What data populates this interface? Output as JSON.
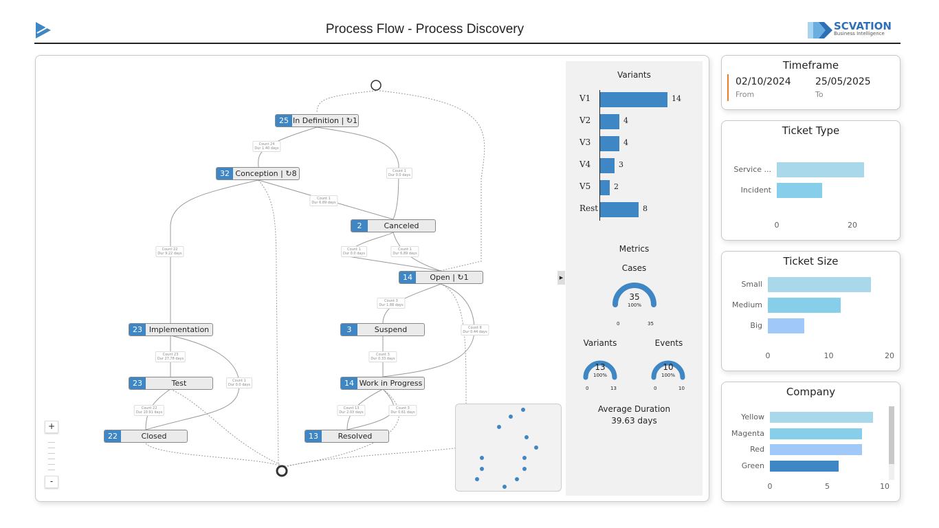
{
  "header": {
    "title": "Process Flow - Process Discovery",
    "logo_text": "SCVATION",
    "logo_sub": "Business Intelligence"
  },
  "graph": {
    "nodes": [
      {
        "count": "25",
        "label": "In Definition | ↻1"
      },
      {
        "count": "32",
        "label": "Conception | ↻8"
      },
      {
        "count": "2",
        "label": "Canceled"
      },
      {
        "count": "14",
        "label": "Open | ↻1"
      },
      {
        "count": "23",
        "label": "Implementation"
      },
      {
        "count": "3",
        "label": "Suspend"
      },
      {
        "count": "23",
        "label": "Test"
      },
      {
        "count": "14",
        "label": "Work in Progress"
      },
      {
        "count": "22",
        "label": "Closed"
      },
      {
        "count": "13",
        "label": "Resolved"
      }
    ],
    "edges": [
      {
        "count": "Count 24",
        "dur": "Dur 1.40 days"
      },
      {
        "count": "Count 1",
        "dur": "Dur 0.0 days"
      },
      {
        "count": "Count 1",
        "dur": "Dur 6.89 days"
      },
      {
        "count": "Count 22",
        "dur": "Dur 9.22 days"
      },
      {
        "count": "Count 1",
        "dur": "Dur 0.0 days"
      },
      {
        "count": "Count 1",
        "dur": "Dur 6.89 days"
      },
      {
        "count": "Count 3",
        "dur": "Dur 1.88 days"
      },
      {
        "count": "Count 8",
        "dur": "Dur 0.44 days"
      },
      {
        "count": "Count 23",
        "dur": "Dur 27.78 days"
      },
      {
        "count": "Count 3",
        "dur": "Dur 0.33 days"
      },
      {
        "count": "Count 1",
        "dur": "Dur 0.0 days"
      },
      {
        "count": "Count 22",
        "dur": "Dur 10.91 days"
      },
      {
        "count": "Count 13",
        "dur": "Dur 2.03 days"
      },
      {
        "count": "Count 3",
        "dur": "Dur 0.61 days"
      }
    ],
    "zoom_in": "+",
    "zoom_out": "-"
  },
  "variants": {
    "title": "Variants",
    "color": "#3f87c4",
    "items": [
      {
        "label": "V1",
        "value": 14
      },
      {
        "label": "V2",
        "value": 4
      },
      {
        "label": "V3",
        "value": 4
      },
      {
        "label": "V4",
        "value": 3
      },
      {
        "label": "V5",
        "value": 2
      },
      {
        "label": "Rest",
        "value": 8
      }
    ]
  },
  "metrics": {
    "title": "Metrics",
    "cases": {
      "label": "Cases",
      "value": "35",
      "pct": "100%",
      "min": "0",
      "max": "35"
    },
    "variants": {
      "label": "Variants",
      "value": "13",
      "pct": "100%",
      "min": "0",
      "max": "13"
    },
    "events": {
      "label": "Events",
      "value": "10",
      "pct": "100%",
      "min": "0",
      "max": "10"
    },
    "avg_label": "Average Duration",
    "avg_value": "39.63 days"
  },
  "timeframe": {
    "title": "Timeframe",
    "from": "02/10/2024",
    "from_label": "From",
    "to": "25/05/2025",
    "to_label": "To",
    "accent": "#e8801f"
  },
  "chart_data": [
    {
      "type": "bar",
      "title": "Variants",
      "categories": [
        "V1",
        "V2",
        "V3",
        "V4",
        "V5",
        "Rest"
      ],
      "values": [
        14,
        4,
        4,
        3,
        2,
        8
      ]
    },
    {
      "type": "bar",
      "title": "Ticket Type",
      "categories": [
        "Service ...",
        "Incident"
      ],
      "values": [
        23,
        12
      ],
      "xlim": [
        0,
        25
      ],
      "xticks": [
        "0",
        "20"
      ]
    },
    {
      "type": "bar",
      "title": "Ticket Size",
      "categories": [
        "Small",
        "Medium",
        "Big"
      ],
      "values": [
        17,
        12,
        6
      ],
      "xlim": [
        0,
        20
      ],
      "xticks": [
        "0",
        "10",
        "20"
      ]
    },
    {
      "type": "bar",
      "title": "Company",
      "categories": [
        "Yellow",
        "Magenta",
        "Red",
        "Green"
      ],
      "values": [
        9,
        8,
        8,
        6
      ],
      "xlim": [
        0,
        10
      ],
      "xticks": [
        "0",
        "5",
        "10"
      ]
    }
  ]
}
